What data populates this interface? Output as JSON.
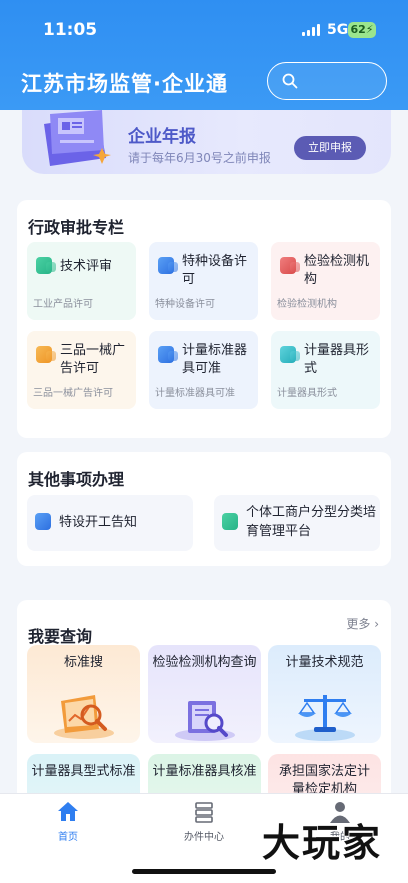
{
  "status_bar": {
    "time": "11:05",
    "network": "5G",
    "battery": "62"
  },
  "header": {
    "title": "江苏市场监管·企业通",
    "search_icon": "search-icon"
  },
  "banner": {
    "title": "企业年报",
    "subtitle": "请于每年6月30号之前申报",
    "button": "立即申报"
  },
  "admin_section": {
    "title": "行政审批专栏",
    "items": [
      {
        "name": "技术评审",
        "sub": "工业产品许可",
        "color": "green"
      },
      {
        "name": "特种设备许可",
        "sub": "特种设备许可",
        "color": "blue"
      },
      {
        "name": "检验检测机构",
        "sub": "检验检测机构",
        "color": "red"
      },
      {
        "name": "三品一械广告许可",
        "sub": "三品一械广告许可",
        "color": "orange"
      },
      {
        "name": "计量标准器具可准",
        "sub": "计量标准器具可准",
        "color": "blue"
      },
      {
        "name": "计量器具形式",
        "sub": "计量器具形式",
        "color": "cyan"
      }
    ]
  },
  "other_section": {
    "title": "其他事项办理",
    "items": [
      {
        "name": "特设开工告知"
      },
      {
        "name": "个体工商户分型分类培育管理平台"
      }
    ]
  },
  "query_section": {
    "title": "我要查询",
    "more": "更多",
    "items": [
      {
        "name": "标准搜"
      },
      {
        "name": "检验检测机构查询"
      },
      {
        "name": "计量技术规范"
      },
      {
        "name": "计量器具型式标准"
      },
      {
        "name": "计量标准器具核准"
      },
      {
        "name": "承担国家法定计量检定机构"
      }
    ]
  },
  "tabbar": {
    "tabs": [
      {
        "label": "首页",
        "icon": "home-icon",
        "active": true
      },
      {
        "label": "办件中心",
        "icon": "server-icon",
        "active": false
      },
      {
        "label": "我的",
        "icon": "user-icon",
        "active": false
      }
    ]
  },
  "watermark": "大玩家",
  "colors": {
    "primary": "#2f8ff2",
    "active_tab": "#2f7ef0",
    "banner_button": "#5b5bb4"
  }
}
